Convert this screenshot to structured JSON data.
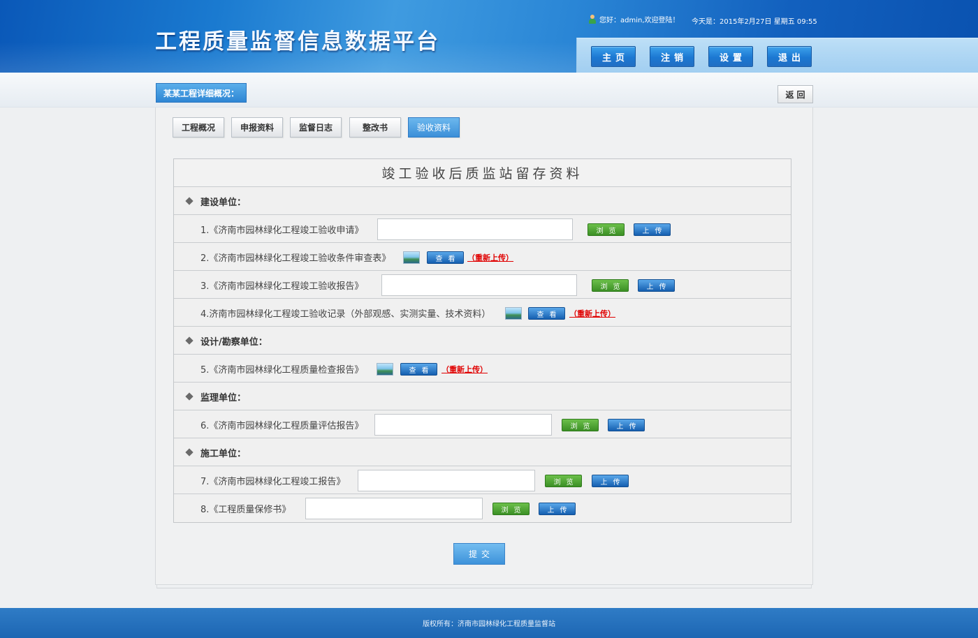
{
  "header": {
    "site_title": "工程质量监督信息数据平台",
    "greeting": "您好：admin,欢迎登陆！",
    "date_text": "今天是：2015年2月27日  星期五  09:55"
  },
  "nav": {
    "home": "主页",
    "logout": "注销",
    "settings": "设置",
    "exit": "退出"
  },
  "breadcrumb": "某某工程详细概况：",
  "back_label": "返回",
  "tabs": [
    "工程概况",
    "申报资料",
    "监督日志",
    "整改书",
    "验收资料"
  ],
  "active_tab": 4,
  "table": {
    "title": "竣工验收后质监站留存资料",
    "sections": {
      "construction_unit": "建设单位：",
      "design_unit": "设计/勘察单位：",
      "supervision_unit": "监理单位：",
      "builder_unit": "施工单位："
    },
    "items": {
      "item1": "1.《济南市园林绿化工程竣工验收申请》",
      "item2": "2.《济南市园林绿化工程竣工验收条件审查表》",
      "item3": "3.《济南市园林绿化工程竣工验收报告》",
      "item4": "4.济南市园林绿化工程竣工验收记录（外部观感、实测实量、技术资料）",
      "item5": "5.《济南市园林绿化工程质量检查报告》",
      "item6": "6.《济南市园林绿化工程质量评估报告》",
      "item7": "7.《济南市园林绿化工程竣工报告》",
      "item8": "8.《工程质量保修书》"
    },
    "browse_label": "浏览",
    "upload_label": "上传",
    "view_label": "查看",
    "reupload_label": "（重新上传）"
  },
  "submit_label": "提交",
  "footer_text": "版权所有：济南市园林绿化工程质量监督站"
}
